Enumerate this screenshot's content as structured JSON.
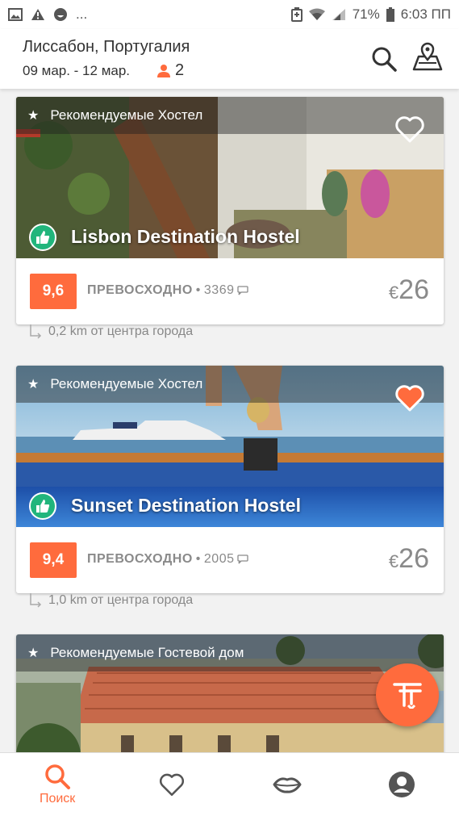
{
  "status_bar": {
    "left_icons": [
      "image-icon",
      "warning-icon",
      "smiley-icon"
    ],
    "more": "...",
    "right_icons": [
      "data-saver-icon",
      "wifi-icon",
      "signal-icon"
    ],
    "battery": "71%",
    "time": "6:03 ПП"
  },
  "header": {
    "title": "Лиссабон, Португалия",
    "dates": "09 мар. - 12 мар.",
    "guests": "2",
    "colors": {
      "accent": "#ff6b3d"
    }
  },
  "listings": [
    {
      "recommended": "Рекомендуемые Хостел",
      "name": "Lisbon Destination Hostel",
      "favorite": false,
      "score": "9,6",
      "rating_label": "ПРЕВОСХОДНО",
      "reviews": "3369",
      "currency": "€",
      "price": "26",
      "distance": "0,2 km от центра города"
    },
    {
      "recommended": "Рекомендуемые Хостел",
      "name": "Sunset Destination Hostel",
      "favorite": true,
      "score": "9,4",
      "rating_label": "ПРЕВОСХОДНО",
      "reviews": "2005",
      "currency": "€",
      "price": "26",
      "distance": "1,0 km от центра города"
    },
    {
      "recommended": "Рекомендуемые Гостевой дом"
    }
  ],
  "bottom_nav": {
    "search_label": "Поиск"
  },
  "colors": {
    "accent": "#ff6b3d",
    "badge_green": "#21b57c",
    "favorite_active": "#ff6b3d"
  }
}
